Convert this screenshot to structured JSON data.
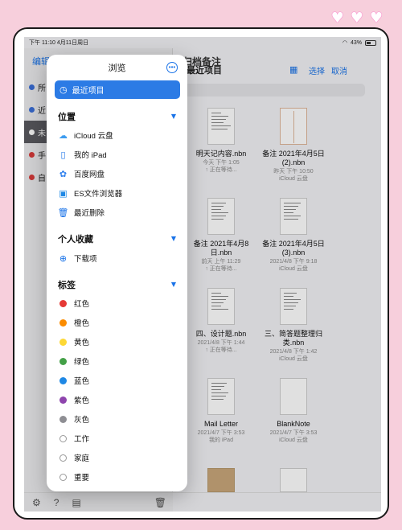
{
  "status": {
    "time": "下午 11:10",
    "date": "4月11日周日",
    "battery": "43%"
  },
  "background": {
    "edit": "编辑",
    "app_title": "未归档备注",
    "header": "最近项目",
    "select": "选择",
    "cancel": "取消",
    "sidebar_items": [
      {
        "label": "所",
        "color": "#3b6fd9"
      },
      {
        "label": "近",
        "color": "#3b6fd9"
      },
      {
        "label": "未",
        "color": "#222222"
      },
      {
        "label": "手",
        "color": "#d93b3b"
      },
      {
        "label": "自",
        "color": "#d93b3b"
      }
    ],
    "files": [
      {
        "name": "明天记内容.nbn",
        "meta": "今天 下午 1:05",
        "loc": "↑ 正在等待...",
        "style": "plain"
      },
      {
        "name": "备注 2021年4月5日 (2).nbn",
        "meta": "昨天 下午 10:50",
        "loc": "iCloud 云盘",
        "style": "lined"
      },
      {
        "name": "备注 2021年4月8日.nbn",
        "meta": "前天 上午 11:29",
        "loc": "↑ 正在等待...",
        "style": "plain"
      },
      {
        "name": "备注 2021年4月5日 (3).nbn",
        "meta": "2021/4/8 下午 9:18",
        "loc": "iCloud 云盘",
        "style": "plain"
      },
      {
        "name": "四、设计题.nbn",
        "meta": "2021/4/8 下午 1:44",
        "loc": "↑ 正在等待...",
        "style": "plain"
      },
      {
        "name": "三、简答题整理归类.nbn",
        "meta": "2021/4/8 下午 1:42",
        "loc": "iCloud 云盘",
        "style": "plain"
      },
      {
        "name": "Mail Letter",
        "meta": "2021/4/7 下午 3:53",
        "loc": "我的 iPad",
        "style": "plain"
      },
      {
        "name": "BlankNote",
        "meta": "2021/4/7 下午 3:53",
        "loc": "iCloud 云盘",
        "style": "blank"
      }
    ]
  },
  "panel": {
    "title": "浏览",
    "recent": "最近项目",
    "locations_title": "位置",
    "locations": [
      {
        "label": "iCloud 云盘",
        "icon": "cloud-icon"
      },
      {
        "label": "我的 iPad",
        "icon": "ipad-icon"
      },
      {
        "label": "百度网盘",
        "icon": "baidu-icon"
      },
      {
        "label": "ES文件浏览器",
        "icon": "es-icon"
      },
      {
        "label": "最近删除",
        "icon": "trash-icon"
      }
    ],
    "favorites_title": "个人收藏",
    "favorites": [
      {
        "label": "下载项",
        "icon": "download-icon"
      }
    ],
    "tags_title": "标签",
    "tags": [
      {
        "label": "红色",
        "color": "#e53935"
      },
      {
        "label": "橙色",
        "color": "#fb8c00"
      },
      {
        "label": "黄色",
        "color": "#fdd835"
      },
      {
        "label": "绿色",
        "color": "#43a047"
      },
      {
        "label": "蓝色",
        "color": "#1e88e5"
      },
      {
        "label": "紫色",
        "color": "#8e44ad"
      },
      {
        "label": "灰色",
        "color": "#8e8e93"
      },
      {
        "label": "工作",
        "color": ""
      },
      {
        "label": "家庭",
        "color": ""
      },
      {
        "label": "重要",
        "color": ""
      }
    ]
  }
}
